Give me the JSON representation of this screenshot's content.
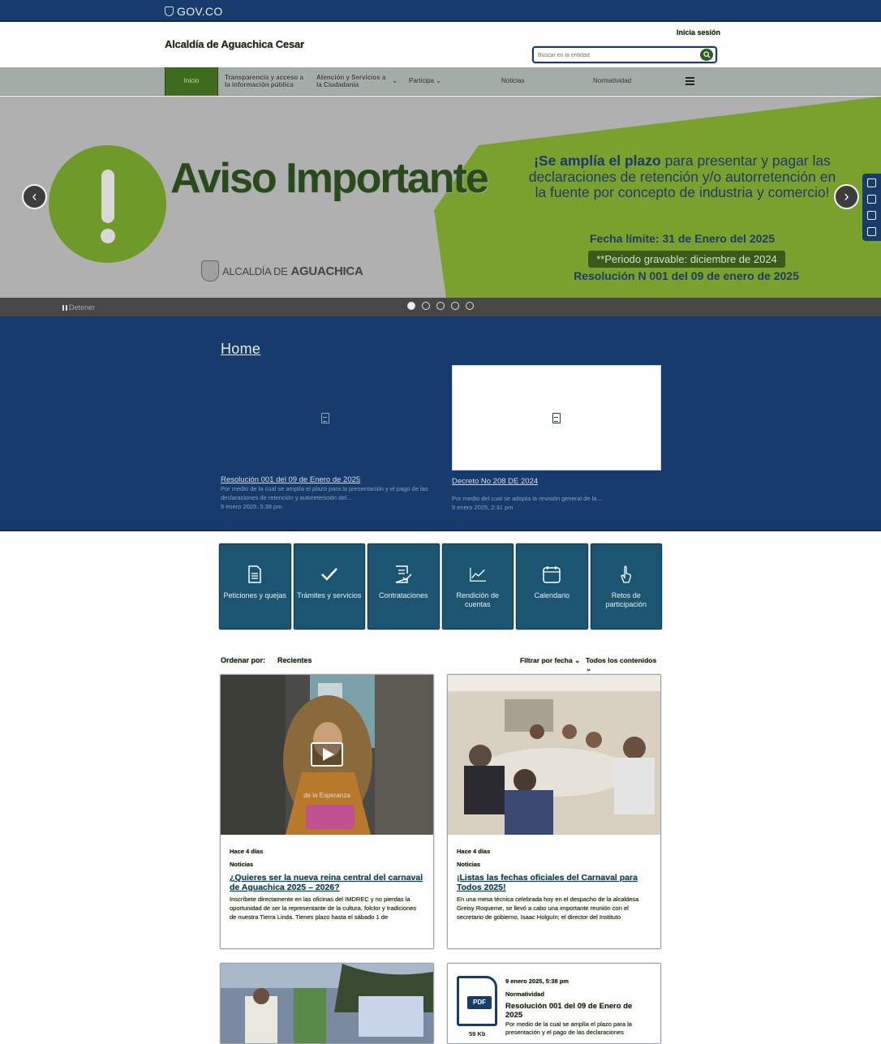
{
  "gov_bar": {
    "logo_text": "GOV.CO"
  },
  "header": {
    "site_title": "Alcaldía de Aguachica Cesar",
    "login_label": "Inicia sesión",
    "search_placeholder": "Buscar en la entidad"
  },
  "nav": {
    "items": [
      {
        "label": "Inicio"
      },
      {
        "label": "Transparencia y acceso a la información pública"
      },
      {
        "label": "Atención y Servicios a la Ciudadanía"
      },
      {
        "label": "Participa"
      },
      {
        "label": "Noticias"
      },
      {
        "label": "Normatividad"
      }
    ]
  },
  "carousel": {
    "headline": "Aviso Importante",
    "logo_prefix": "ALCALDÍA DE",
    "logo_name": "AGUACHICA",
    "promo_lead": "¡Se amplía el plazo",
    "promo_rest": "para presentar y pagar las declaraciones de retención y/o autorretención en la fuente por concepto de industria y comercio!",
    "deadline": "Fecha límite: 31 de Enero del 2025",
    "periodo": "**Periodo gravable: diciembre de 2024",
    "resolucion": "Resolución N 001 del 09 de enero de 2025",
    "prev_symbol": "‹",
    "next_symbol": "›",
    "stop_label": "Detener",
    "active_slide": 1,
    "slide_count": 5
  },
  "home": {
    "title": "Home",
    "items": [
      {
        "title": "Resolución 001 del 09 de Enero de 2025",
        "desc": "Por medio de la cual se amplía el plazo para la presentación y el pago de las declaraciones de retención y autoretención del...",
        "date": "9 enero 2025, 5:38 pm"
      },
      {
        "title": "Decreto No 208 DE 2024",
        "desc": "Por medio del cual se adopta la revisión general de la...",
        "date": "9 enero 2025, 2:31 pm"
      }
    ]
  },
  "quick_links": [
    {
      "label": "Peticiones y quejas",
      "icon": "document-icon"
    },
    {
      "label": "Trámites y servicios",
      "icon": "check-icon"
    },
    {
      "label": "Contrataciones",
      "icon": "contract-icon"
    },
    {
      "label": "Rendición de cuentas",
      "icon": "chart-icon"
    },
    {
      "label": "Calendario",
      "icon": "calendar-icon"
    },
    {
      "label": "Retos de participación",
      "icon": "hand-icon"
    }
  ],
  "sort": {
    "label": "Ordenar por:",
    "value": "Recientes",
    "filter_date": "Filtrar por fecha",
    "filter_all": "Todos los contenidos"
  },
  "news": [
    {
      "when": "Hace 4 días",
      "category": "Noticias",
      "title": "¿Quieres ser la nueva reina central del carnaval de Aguachica 2025 – 2026?",
      "desc": "Inscríbete directamente en las oficinas del IMDREC y no pierdas la oportunidad de ser la representante de la cultura, folclor y tradiciones de nuestra Tierra Linda. Tienes plazo hasta el sábado 1 de",
      "overlay_text": "de la Esperanza"
    },
    {
      "when": "Hace 4 días",
      "category": "Noticias",
      "title": "¡Listas las fechas oficiales del Carnaval para Todos 2025!",
      "desc": "En una mesa técnica celebrada hoy en el despacho de la alcaldesa Greisy Roqueme, se llevó a cabo una importante reunión con el secretario de gobierno, Isaac Holguín; el director del Instituto"
    },
    {
      "date": "9 enero 2025, 5:38 pm",
      "category": "Normatividad",
      "title": "Resolución 001 del 09 de Enero de 2025",
      "desc": "Por medio de la cual se amplía el plazo para la presentación y el pago de las declaraciones",
      "pdf_label": "PDF",
      "size": "59 Kb"
    }
  ],
  "colors": {
    "gov_blue": "#173b6c",
    "nav_green": "#3e6b1c",
    "tile_teal": "#1b5571"
  }
}
